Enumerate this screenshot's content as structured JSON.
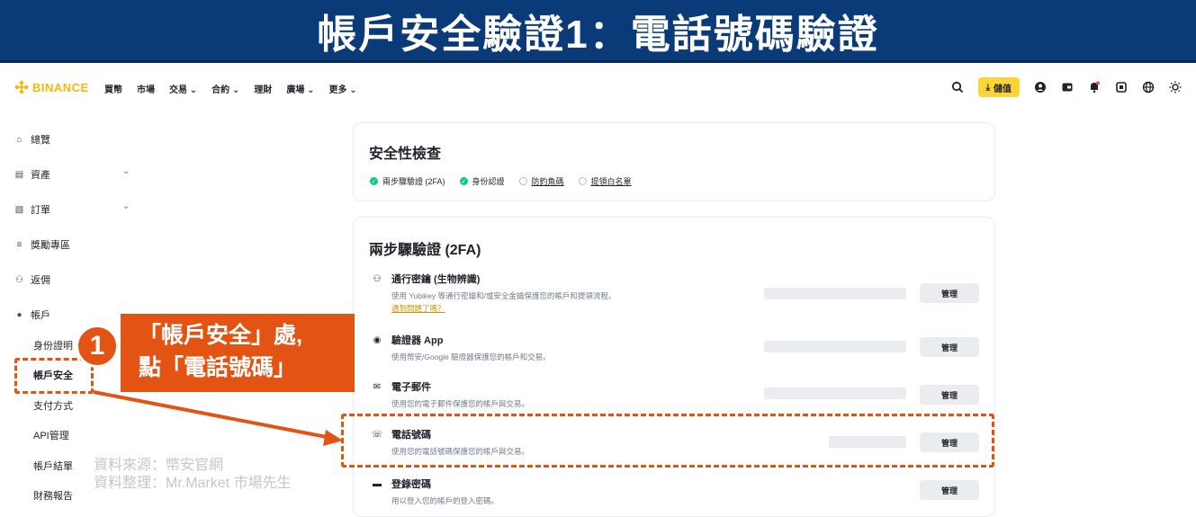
{
  "banner": {
    "title": "帳戶安全驗證1：電話號碼驗證"
  },
  "nav": {
    "brand": "BINANCE",
    "links": [
      "買幣",
      "市場",
      "交易 ⌄",
      "合約 ⌄",
      "理財",
      "廣場 ⌄",
      "更多 ⌄"
    ],
    "deposit": "儲值",
    "icons": [
      "search-icon",
      "profile-icon",
      "wallet-icon",
      "bell-icon",
      "download-icon",
      "globe-icon",
      "theme-icon"
    ]
  },
  "sidebar": {
    "items": [
      {
        "label": "總覽",
        "icon": "⌂"
      },
      {
        "label": "資產",
        "icon": "▤"
      },
      {
        "label": "訂單",
        "icon": "▧"
      },
      {
        "label": "獎勵專區",
        "icon": "≡"
      },
      {
        "label": "返佣",
        "icon": "⚇"
      },
      {
        "label": "帳戶",
        "icon": "●"
      }
    ],
    "sub_items": [
      "身份證明",
      "帳戶安全",
      "支付方式",
      "API管理",
      "帳戶結單",
      "財務報告"
    ],
    "chevron": "⌄"
  },
  "security_check": {
    "title": "安全性檢查",
    "items": [
      {
        "label": "兩步驟驗證 (2FA)",
        "status": "on"
      },
      {
        "label": "身份認證",
        "status": "on"
      },
      {
        "label": "防釣魚碼",
        "status": "off"
      },
      {
        "label": "提領白名單",
        "status": "off"
      }
    ]
  },
  "twofa": {
    "title": "兩步驟驗證 (2FA)",
    "manage_label": "管理",
    "rows": [
      {
        "title": "通行密鑰 (生物辨識)",
        "icon": "⚇",
        "desc": "使用 Yubikey 等通行密鑰和/或安全金鑰保護您的帳戶和提領流程。",
        "link": "遇到問題了嗎？"
      },
      {
        "title": "驗證器 App",
        "icon": "◉",
        "desc": "使用幣安/Google 驗證器保護您的帳戶和交易。"
      },
      {
        "title": "電子郵件",
        "icon": "✉",
        "desc": "使用您的電子郵件保護您的帳戶與交易。"
      },
      {
        "title": "電話號碼",
        "icon": "☏",
        "desc": "使用您的電話號碼保護您的帳戶與交易。"
      },
      {
        "title": "登錄密碼",
        "icon": "▬",
        "desc": "用以登入您的帳戶的登入密碼。"
      }
    ]
  },
  "annotation": {
    "step": "1",
    "line1": "「帳戶安全」處,",
    "line2": "點「電話號碼」",
    "accent": "#e35414"
  },
  "source": {
    "line1": "資料來源：幣安官網",
    "line2": "資料整理：Mr.Market 市場先生"
  }
}
